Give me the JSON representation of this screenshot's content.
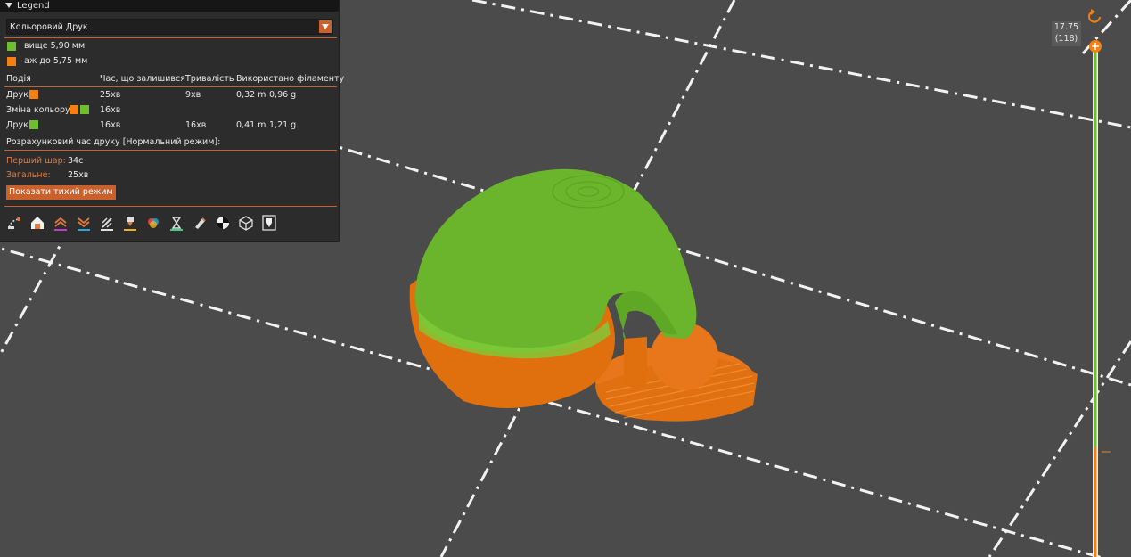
{
  "legend": {
    "title": "Legend",
    "view_mode": "Кольоровий Друк",
    "color_items": [
      {
        "label": "вище 5,90 мм",
        "color": "#6fbe2c"
      },
      {
        "label": "аж до 5,75 мм",
        "color": "#f57f0f"
      }
    ],
    "columns": [
      "Подія",
      "Час, що залишився",
      "Тривалість",
      "Використано філаменту"
    ],
    "rows": [
      {
        "event": "Друк",
        "remaining": "25хв",
        "duration": "9хв",
        "length": "0,32 m",
        "weight": "0,96 g"
      },
      {
        "event": "Зміна кольору",
        "remaining": "16хв",
        "duration": "",
        "length": "",
        "weight": ""
      },
      {
        "event": "Друк",
        "remaining": "16хв",
        "duration": "16хв",
        "length": "0,41 m",
        "weight": "1,21 g"
      }
    ],
    "estimated_label": "Розрахунковий час друку [Нормальний режим]:",
    "first_layer_label": "Перший шар:",
    "first_layer_value": "34с",
    "total_label": "Загальне:",
    "total_value": "25хв",
    "quiet_button": "Показати тихий режим",
    "toolbar_icons": [
      "travel-icon",
      "wipe-icon",
      "retractions-icon",
      "deretractions-icon",
      "seams-icon",
      "tool-changes-icon",
      "color-changes-icon",
      "pause-icon",
      "custom-gcode-icon",
      "center-of-gravity-icon",
      "shells-icon",
      "tool-marker-icon"
    ]
  },
  "slider": {
    "value": "17.75",
    "layer": "(118)"
  },
  "colors": {
    "accent": "#c8612b",
    "green": "#6fbe2c",
    "orange": "#f57f0f",
    "background": "#4b4b4b"
  }
}
